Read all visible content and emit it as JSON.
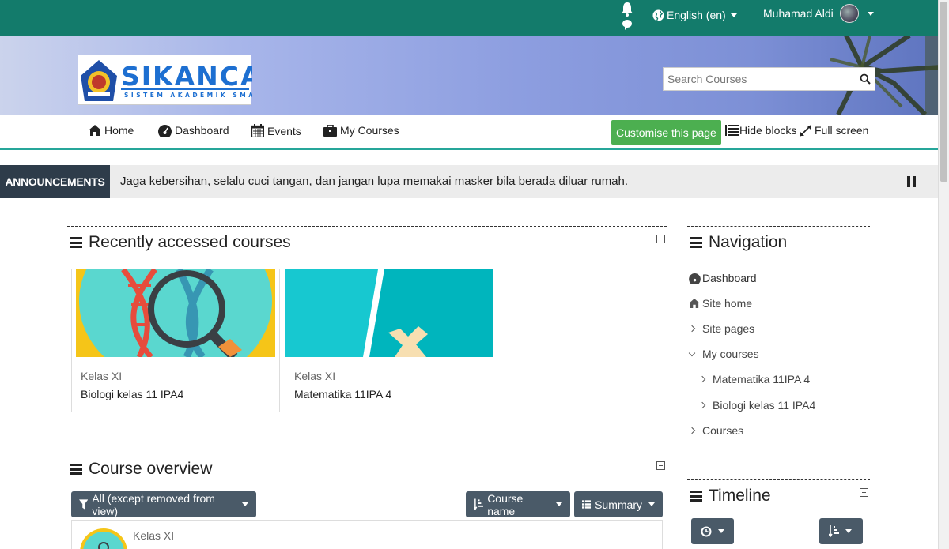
{
  "topbar": {
    "language": "English (en)",
    "user_name": "Muhamad Aldi",
    "colors": {
      "bar": "#137b6b"
    }
  },
  "header": {
    "logo_text": "SIKANCA",
    "logo_subtitle": "SISTEM AKADEMIK SMANCA",
    "search_placeholder": "Search Courses"
  },
  "nav": {
    "home": "Home",
    "dashboard": "Dashboard",
    "events": "Events",
    "my_courses": "My Courses",
    "customise": "Customise this page",
    "hide_blocks": "Hide blocks",
    "full_screen": "Full screen"
  },
  "announcement": {
    "label": "ANNOUNCEMENTS",
    "text": "Jaga kebersihan, selalu cuci tangan, dan jangan lupa memakai masker bila berada diluar rumah."
  },
  "recent": {
    "title": "Recently accessed courses",
    "courses": [
      {
        "category": "Kelas XI",
        "name": "Biologi kelas 11 IPA4"
      },
      {
        "category": "Kelas XI",
        "name": "Matematika 11IPA 4"
      }
    ]
  },
  "overview": {
    "title": "Course overview",
    "filter": "All (except removed from view)",
    "sort": "Course name",
    "view": "Summary",
    "first_item_category": "Kelas XI"
  },
  "navigation": {
    "title": "Navigation",
    "dashboard": "Dashboard",
    "site_home": "Site home",
    "site_pages": "Site pages",
    "my_courses": "My courses",
    "course1": "Matematika 11IPA 4",
    "course2": "Biologi kelas 11 IPA4",
    "courses": "Courses"
  },
  "timeline": {
    "title": "Timeline"
  }
}
